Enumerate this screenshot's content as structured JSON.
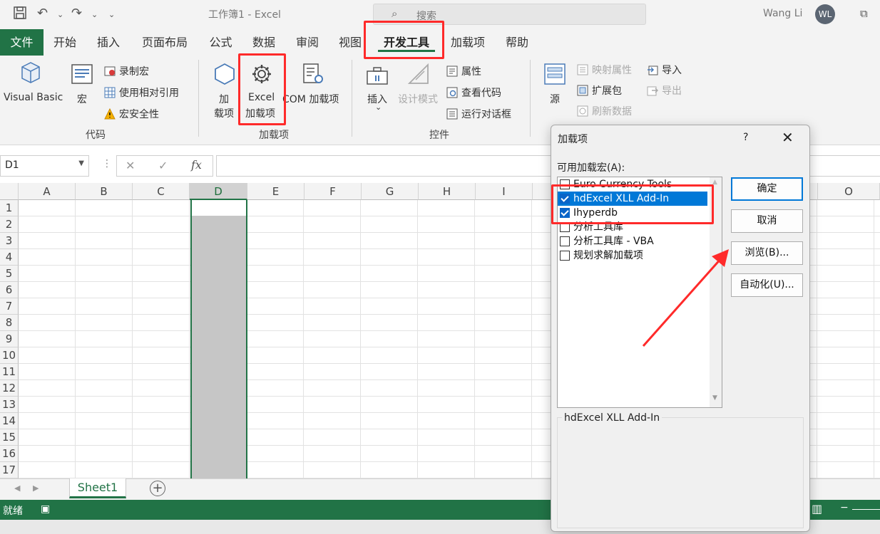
{
  "title_bar": {
    "doc_title": "工作簿1  -  Excel",
    "search_placeholder": "搜索",
    "user_name": "Wang Li",
    "user_initials": "WL",
    "undo_arrow": "⌄",
    "customize_arrow": "⌄"
  },
  "ribbon_tabs": [
    "文件",
    "开始",
    "插入",
    "页面布局",
    "公式",
    "数据",
    "审阅",
    "视图",
    "开发工具",
    "加载项",
    "帮助"
  ],
  "ribbon": {
    "code": {
      "visual_basic": "Visual Basic",
      "macros": "宏",
      "record_macro": "录制宏",
      "use_relative": "使用相对引用",
      "macro_security": "宏安全性",
      "group": "代码"
    },
    "addins": {
      "addins_line1": "加",
      "addins_line2": "载项",
      "excel_addins_line1": "Excel",
      "excel_addins_line2": "加载项",
      "com_addins": "COM 加载项",
      "group": "加载项"
    },
    "controls": {
      "insert": "插入",
      "insert_arrow": "⌄",
      "design_mode": "设计模式",
      "properties": "属性",
      "view_code": "查看代码",
      "run_dialog": "运行对话框",
      "group": "控件"
    },
    "xml": {
      "source": "源",
      "map_properties": "映射属性",
      "expansion_packs": "扩展包",
      "refresh_data": "刷新数据",
      "import": "导入",
      "export": "导出"
    }
  },
  "formula_bar": {
    "name_box": "D1",
    "cancel": "✕",
    "enter": "✓",
    "fx": "fx",
    "value": ""
  },
  "columns": [
    "A",
    "B",
    "C",
    "D",
    "E",
    "F",
    "G",
    "H",
    "I",
    "O"
  ],
  "rows": [
    "1",
    "2",
    "3",
    "4",
    "5",
    "6",
    "7",
    "8",
    "9",
    "10",
    "11",
    "12",
    "13",
    "14",
    "15",
    "16",
    "17"
  ],
  "sheet_tab": "Sheet1",
  "add_sheet": "+",
  "status_text": "就绪",
  "dialog": {
    "title": "加载项",
    "help": "?",
    "close": "✕",
    "list_label": "可用加载宏(A):",
    "items": [
      {
        "label": "Euro Currency Tools",
        "checked": false
      },
      {
        "label": "hdExcel XLL Add-In",
        "checked": true
      },
      {
        "label": "Ihyperdb",
        "checked": true
      },
      {
        "label": "分析工具库",
        "checked": false
      },
      {
        "label": "分析工具库 - VBA",
        "checked": false
      },
      {
        "label": "规划求解加载项",
        "checked": false
      }
    ],
    "ok": "确定",
    "cancel": "取消",
    "browse": "浏览(B)...",
    "automation": "自动化(U)...",
    "description": "hdExcel XLL Add-In"
  },
  "colors": {
    "excel_green": "#217346",
    "highlight_red": "#ff2a2a",
    "selection_blue": "#0078d7"
  }
}
